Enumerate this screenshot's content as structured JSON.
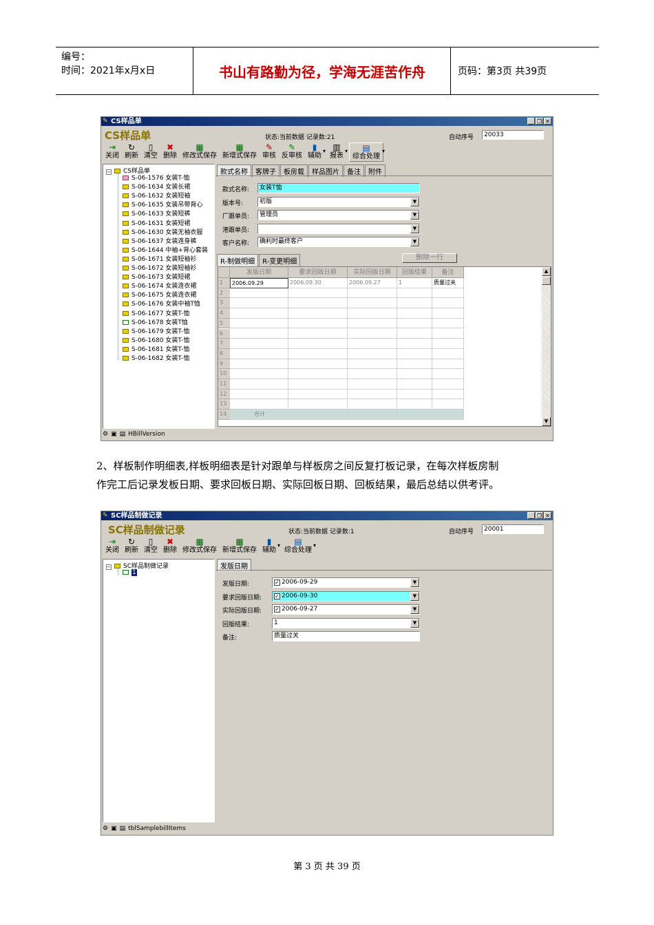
{
  "header": {
    "code_label": "编号：",
    "time_label": "时间：2021年x月x日",
    "motto": "书山有路勤为径，学海无涯苦作舟",
    "page_label": "页码：第3页  共39页"
  },
  "win1": {
    "title": "CS样品单",
    "big_title": "CS样品单",
    "status": "状态:当前数据 记录数:21",
    "auto_label": "自动序号",
    "auto_value": "20033",
    "toolbar": [
      "关闭",
      "刷新",
      "清空",
      "删除",
      "修改式保存",
      "新增式保存",
      "审核",
      "反审核",
      "辅助",
      "报表",
      "综合处理"
    ],
    "tree_root": "CS样品单",
    "tree_items": [
      "S-06-1576 女装T-恤",
      "S-06-1634 女装长裙",
      "S-06-1632 女装短袖",
      "S-06-1635 女装吊带背心",
      "S-06-1633 女装短裤",
      "S-06-1631 女装短裙",
      "S-06-1630 女装无袖衣服",
      "S-06-1637 女装连身裤",
      "S-06-1644 中袖+背心套装",
      "S-06-1671 女装短袖衫",
      "S-06-1672 女装短袖衫",
      "S-06-1673 女装短裙",
      "S-06-1674 女装连衣裙",
      "S-06-1675 女装连衣裙",
      "S-06-1676 女装中袖T恤",
      "S-06-1677 女装T-恤",
      "S-06-1678 女装T恤",
      "S-06-1679 女装T-恤",
      "S-06-1680 女装T-恤",
      "S-06-1681 女装T-恤",
      "S-06-1682 女装T-恤"
    ],
    "tabs": [
      "款式名称",
      "客牌子",
      "板房载",
      "样品图片",
      "备注",
      "附件"
    ],
    "fields": [
      {
        "label": "款式名称:",
        "value": "女装T恤"
      },
      {
        "label": "版本号:",
        "value": "初版"
      },
      {
        "label": "厂跟单员:",
        "value": "管理员"
      },
      {
        "label": "港跟单员:",
        "value": ""
      },
      {
        "label": "客户名称:",
        "value": "确利时最终客户"
      }
    ],
    "subtabs": [
      "R-制做明细",
      "R-变更明细"
    ],
    "delete_row": "删除一行",
    "grid_headers": [
      "发版日期",
      "要求回版日期",
      "实际回版日期",
      "回版结果",
      "备注"
    ],
    "grid_row1": [
      "2006.09.29",
      "2006.09.30",
      "2006.09.27",
      "1",
      "质量过关"
    ],
    "row_numbers": [
      "1",
      "2",
      "3",
      "4",
      "5",
      "6",
      "7",
      "8",
      "9",
      "10",
      "11",
      "12",
      "13",
      "14"
    ],
    "total_label": "合计",
    "statusbar": "HBillVersion"
  },
  "paragraph": {
    "line1": "2、样板制作明细表,样板明细表是针对跟单与样板房之间反复打板记录，在每次样板房制",
    "line2": "作完工后记录发板日期、要求回板日期、实际回板日期、回板结果，最后总结以供考评。"
  },
  "win2": {
    "title": "SC样品制做记录",
    "big_title": "SC样品制做记录",
    "status": "状态:当前数据 记录数:1",
    "auto_label": "自动序号",
    "auto_value": "20001",
    "toolbar": [
      "关闭",
      "刷新",
      "清空",
      "删除",
      "修改式保存",
      "新增式保存",
      "辅助",
      "综合处理"
    ],
    "tree_root": "SC样品制做记录",
    "tree_item": "1",
    "tab": "发版日期",
    "fields": [
      {
        "label": "发版日期:",
        "value": "2006-09-29"
      },
      {
        "label": "要求回版日期:",
        "value": "2006-09-30"
      },
      {
        "label": "实际回版日期:",
        "value": "2006-09-27"
      },
      {
        "label": "回版结果:",
        "value": "1"
      },
      {
        "label": "备注:",
        "value": "质量过关"
      }
    ],
    "statusbar": "tblSamplebillItems"
  },
  "footer": "第 3 页 共 39 页"
}
